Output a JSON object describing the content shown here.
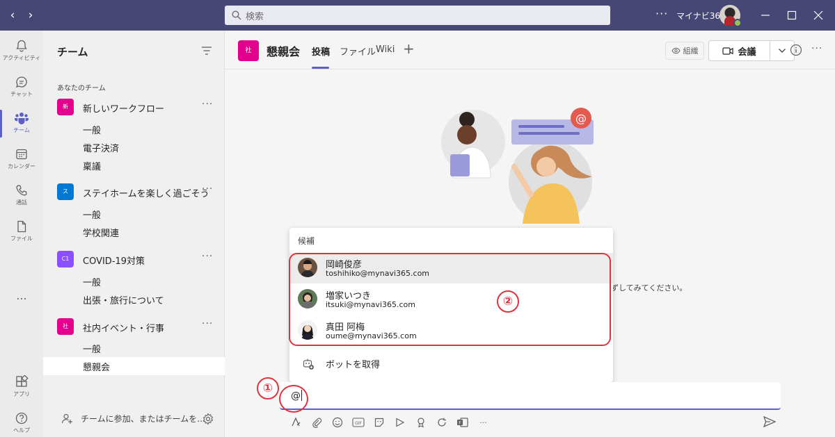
{
  "titlebar": {
    "search_placeholder": "検索",
    "user_name": "マイナビ365"
  },
  "rail": {
    "items": [
      {
        "label": "アクティビティ",
        "icon": "bell-icon"
      },
      {
        "label": "チャット",
        "icon": "chat-icon"
      },
      {
        "label": "チーム",
        "icon": "teams-icon"
      },
      {
        "label": "カレンダー",
        "icon": "calendar-icon"
      },
      {
        "label": "通話",
        "icon": "phone-icon"
      },
      {
        "label": "ファイル",
        "icon": "file-icon"
      }
    ],
    "more": "...",
    "apps": "アプリ",
    "help": "ヘルプ"
  },
  "teampane": {
    "title": "チーム",
    "section": "あなたのチーム",
    "teams": [
      {
        "tile": "新",
        "name": "新しいワークフロー",
        "color": "#e3008c",
        "channels": [
          "一般",
          "電子決済",
          "稟議"
        ]
      },
      {
        "tile": "ス",
        "name": "ステイホームを楽しく過ごそう",
        "color": "#0078d4",
        "channels": [
          "一般",
          "学校関連"
        ]
      },
      {
        "tile": "C1",
        "name": "COVID-19対策",
        "color": "#8a4fff",
        "channels": [
          "一般",
          "出張・旅行について"
        ]
      },
      {
        "tile": "社",
        "name": "社内イベント・行事",
        "color": "#e3008c",
        "channels": [
          "一般",
          "懇親会"
        ]
      }
    ],
    "footer": "チームに参加、またはチームを..."
  },
  "header": {
    "tile": "社",
    "channel_name": "懇親会",
    "tabs": [
      "投稿",
      "ファイル",
      "Wiki"
    ],
    "org_label": "組織",
    "meet_label": "会議"
  },
  "hint": "ずしてみてください。",
  "popup": {
    "heading": "候補",
    "suggestions": [
      {
        "name": "岡崎俊彦",
        "email": "toshihiko@mynavi365.com"
      },
      {
        "name": "増家いつき",
        "email": "itsuki@mynavi365.com"
      },
      {
        "name": "真田 阿梅",
        "email": "oume@mynavi365.com"
      }
    ],
    "bot_label": "ボットを取得"
  },
  "compose": {
    "text": "@"
  },
  "annotations": {
    "one": "①",
    "two": "②"
  },
  "colors": {
    "titlebar": "#464775",
    "accent": "#5b5fc7",
    "annotation": "#e0323c"
  }
}
